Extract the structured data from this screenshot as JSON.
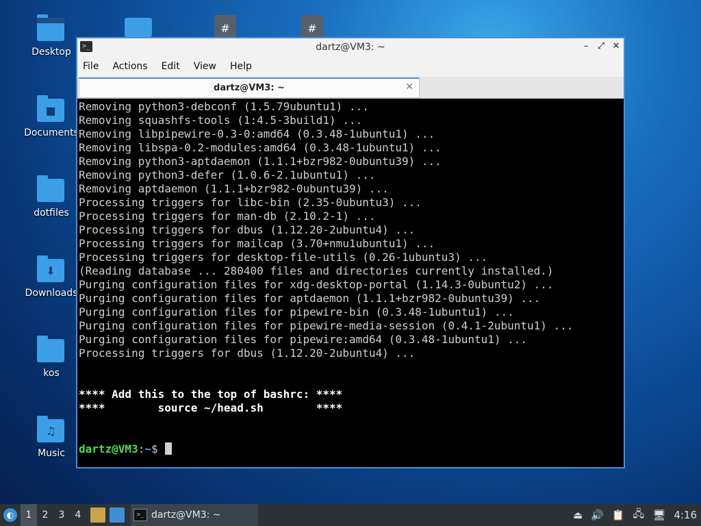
{
  "desktop": {
    "icons": [
      {
        "label": "Desktop",
        "icon": "desktop-folder-icon"
      },
      {
        "label": "Documents",
        "icon": "documents-folder-icon"
      },
      {
        "label": "dotfiles",
        "icon": "folder-icon"
      },
      {
        "label": "Downloads",
        "icon": "downloads-folder-icon"
      },
      {
        "label": "kos",
        "icon": "folder-icon"
      },
      {
        "label": "Music",
        "icon": "music-folder-icon"
      }
    ]
  },
  "window": {
    "title": "dartz@VM3: ~",
    "menu": [
      "File",
      "Actions",
      "Edit",
      "View",
      "Help"
    ],
    "tab_label": "dartz@VM3: ~"
  },
  "terminal": {
    "lines": [
      "Removing python3-debconf (1.5.79ubuntu1) ...",
      "Removing squashfs-tools (1:4.5-3build1) ...",
      "Removing libpipewire-0.3-0:amd64 (0.3.48-1ubuntu1) ...",
      "Removing libspa-0.2-modules:amd64 (0.3.48-1ubuntu1) ...",
      "Removing python3-aptdaemon (1.1.1+bzr982-0ubuntu39) ...",
      "Removing python3-defer (1.0.6-2.1ubuntu1) ...",
      "Removing aptdaemon (1.1.1+bzr982-0ubuntu39) ...",
      "Processing triggers for libc-bin (2.35-0ubuntu3) ...",
      "Processing triggers for man-db (2.10.2-1) ...",
      "Processing triggers for dbus (1.12.20-2ubuntu4) ...",
      "Processing triggers for mailcap (3.70+nmu1ubuntu1) ...",
      "Processing triggers for desktop-file-utils (0.26-1ubuntu3) ...",
      "(Reading database ... 280400 files and directories currently installed.)",
      "Purging configuration files for xdg-desktop-portal (1.14.3-0ubuntu2) ...",
      "Purging configuration files for aptdaemon (1.1.1+bzr982-0ubuntu39) ...",
      "Purging configuration files for pipewire-bin (0.3.48-1ubuntu1) ...",
      "Purging configuration files for pipewire-media-session (0.4.1-2ubuntu1) ...",
      "Purging configuration files for pipewire:amd64 (0.3.48-1ubuntu1) ...",
      "Processing triggers for dbus (1.12.20-2ubuntu4) ..."
    ],
    "notice_line1": "**** Add this to the top of bashrc: ****",
    "notice_line2": "****        source ~/head.sh        ****",
    "prompt_user": "dartz@VM3",
    "prompt_sep": ":",
    "prompt_path": "~",
    "prompt_symbol": "$ "
  },
  "taskbar": {
    "workspaces": [
      "1",
      "2",
      "3",
      "4"
    ],
    "active_workspace": "1",
    "task_label": "dartz@VM3: ~",
    "clock": "4:16"
  }
}
